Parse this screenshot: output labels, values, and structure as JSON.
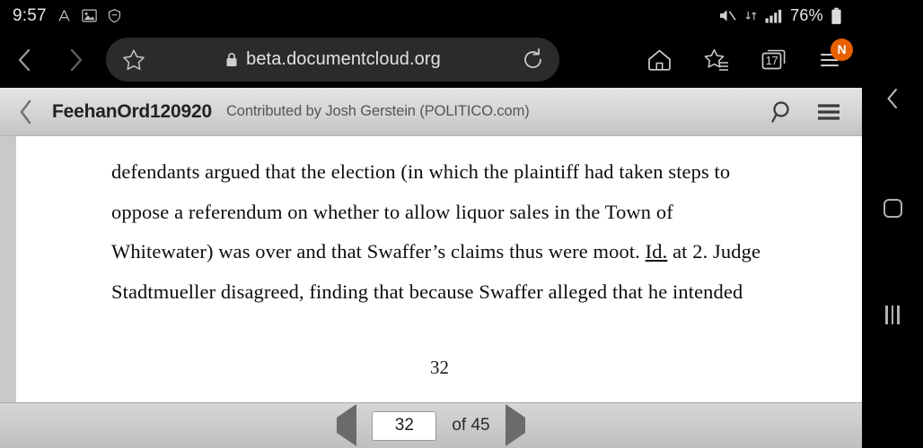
{
  "status_bar": {
    "time": "9:57",
    "left_icons": [
      "font-size-icon",
      "image-icon",
      "vpn-shield-icon"
    ],
    "right_icons": [
      "mute-icon",
      "data-transfer-icon",
      "signal-bars-icon"
    ],
    "battery_percent": "76%",
    "battery_icon": "battery-icon"
  },
  "browser": {
    "back_label": "back-navigation",
    "forward_label": "forward-navigation",
    "url": "beta.documentcloud.org",
    "lock_icon": "lock-icon",
    "star_icon": "star-outline-icon",
    "reload_icon": "reload-icon",
    "home_icon": "home-icon",
    "bookmarks_icon": "bookmarks-star-icon",
    "tabs_icon": "tabs-icon",
    "tab_count": "17",
    "menu_icon": "hamburger-menu-icon",
    "menu_badge": "N",
    "badge_color": "#e66000"
  },
  "doc_header": {
    "back_icon": "chevron-left-icon",
    "title": "FeehanOrd120920",
    "contributor": "Contributed by Josh Gerstein (POLITICO.com)",
    "search_icon": "search-icon",
    "menu_icon": "hamburger-menu-icon"
  },
  "document": {
    "lines": [
      "defendants argued that the election (in which the plaintiff had taken steps to",
      "oppose a referendum on whether to allow liquor sales in the Town of",
      "Whitewater) was over and that Swaffer’s claims thus were moot. Id. at 2. Judge",
      "Stadtmueller disagreed, finding that because Swaffer alleged that he intended"
    ],
    "line3_parts": {
      "before": "Whitewater) was over and that Swaffer’s claims thus were moot. ",
      "underlined": "Id.",
      "after": " at 2. Judge"
    },
    "page_number_footer": "32"
  },
  "pager": {
    "prev_icon": "previous-page-triangle-icon",
    "current_page": "32",
    "total_label": "of 45",
    "next_icon": "next-page-triangle-icon"
  },
  "android_nav": {
    "back_icon": "nav-back-icon",
    "home_icon": "nav-home-icon",
    "recents_icon": "nav-recents-icon"
  }
}
